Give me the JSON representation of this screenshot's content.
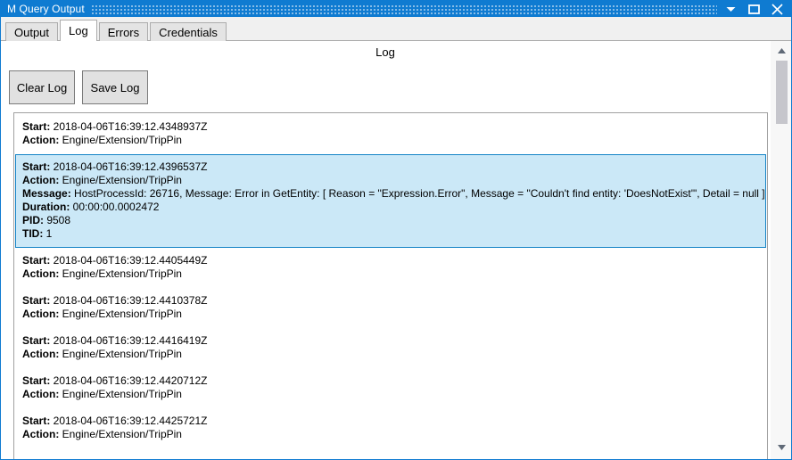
{
  "window": {
    "title": "M Query Output",
    "accent_color": "#0f7bd1",
    "controls": {
      "dropdown_label": "Dropdown",
      "maximize_label": "Maximize",
      "close_label": "Close"
    }
  },
  "tabs": [
    {
      "label": "Output",
      "active": false
    },
    {
      "label": "Log",
      "active": true
    },
    {
      "label": "Errors",
      "active": false
    },
    {
      "label": "Credentials",
      "active": false
    }
  ],
  "page": {
    "title": "Log",
    "buttons": [
      {
        "label": "Clear Log",
        "name": "clear-log-button"
      },
      {
        "label": "Save Log",
        "name": "save-log-button"
      }
    ]
  },
  "log": {
    "selected_index": 1,
    "selection_bg": "#cbe8f7",
    "selection_border": "#1383c6",
    "entries": [
      {
        "selected": false,
        "fields": [
          {
            "key": "Start:",
            "value": "2018-04-06T16:39:12.4348937Z"
          },
          {
            "key": "Action:",
            "value": "Engine/Extension/TripPin"
          }
        ]
      },
      {
        "selected": true,
        "fields": [
          {
            "key": "Start:",
            "value": "2018-04-06T16:39:12.4396537Z"
          },
          {
            "key": "Action:",
            "value": "Engine/Extension/TripPin"
          },
          {
            "key": "Message:",
            "value": "HostProcessId: 26716, Message: Error in GetEntity: [ Reason = \"Expression.Error\", Message = \"Couldn't find entity: 'DoesNotExist'\", Detail = null ]"
          },
          {
            "key": "Duration:",
            "value": "00:00:00.0002472"
          },
          {
            "key": "PID:",
            "value": "9508"
          },
          {
            "key": "TID:",
            "value": "1"
          }
        ]
      },
      {
        "selected": false,
        "fields": [
          {
            "key": "Start:",
            "value": "2018-04-06T16:39:12.4405449Z"
          },
          {
            "key": "Action:",
            "value": "Engine/Extension/TripPin"
          }
        ]
      },
      {
        "selected": false,
        "fields": [
          {
            "key": "Start:",
            "value": "2018-04-06T16:39:12.4410378Z"
          },
          {
            "key": "Action:",
            "value": "Engine/Extension/TripPin"
          }
        ]
      },
      {
        "selected": false,
        "fields": [
          {
            "key": "Start:",
            "value": "2018-04-06T16:39:12.4416419Z"
          },
          {
            "key": "Action:",
            "value": "Engine/Extension/TripPin"
          }
        ]
      },
      {
        "selected": false,
        "fields": [
          {
            "key": "Start:",
            "value": "2018-04-06T16:39:12.4420712Z"
          },
          {
            "key": "Action:",
            "value": "Engine/Extension/TripPin"
          }
        ]
      },
      {
        "selected": false,
        "fields": [
          {
            "key": "Start:",
            "value": "2018-04-06T16:39:12.4425721Z"
          },
          {
            "key": "Action:",
            "value": "Engine/Extension/TripPin"
          }
        ]
      }
    ]
  },
  "scrollbar": {
    "up_arrow_icon": "caret-up-icon",
    "down_arrow_icon": "caret-down-icon",
    "thumb_position_percent": 5
  }
}
